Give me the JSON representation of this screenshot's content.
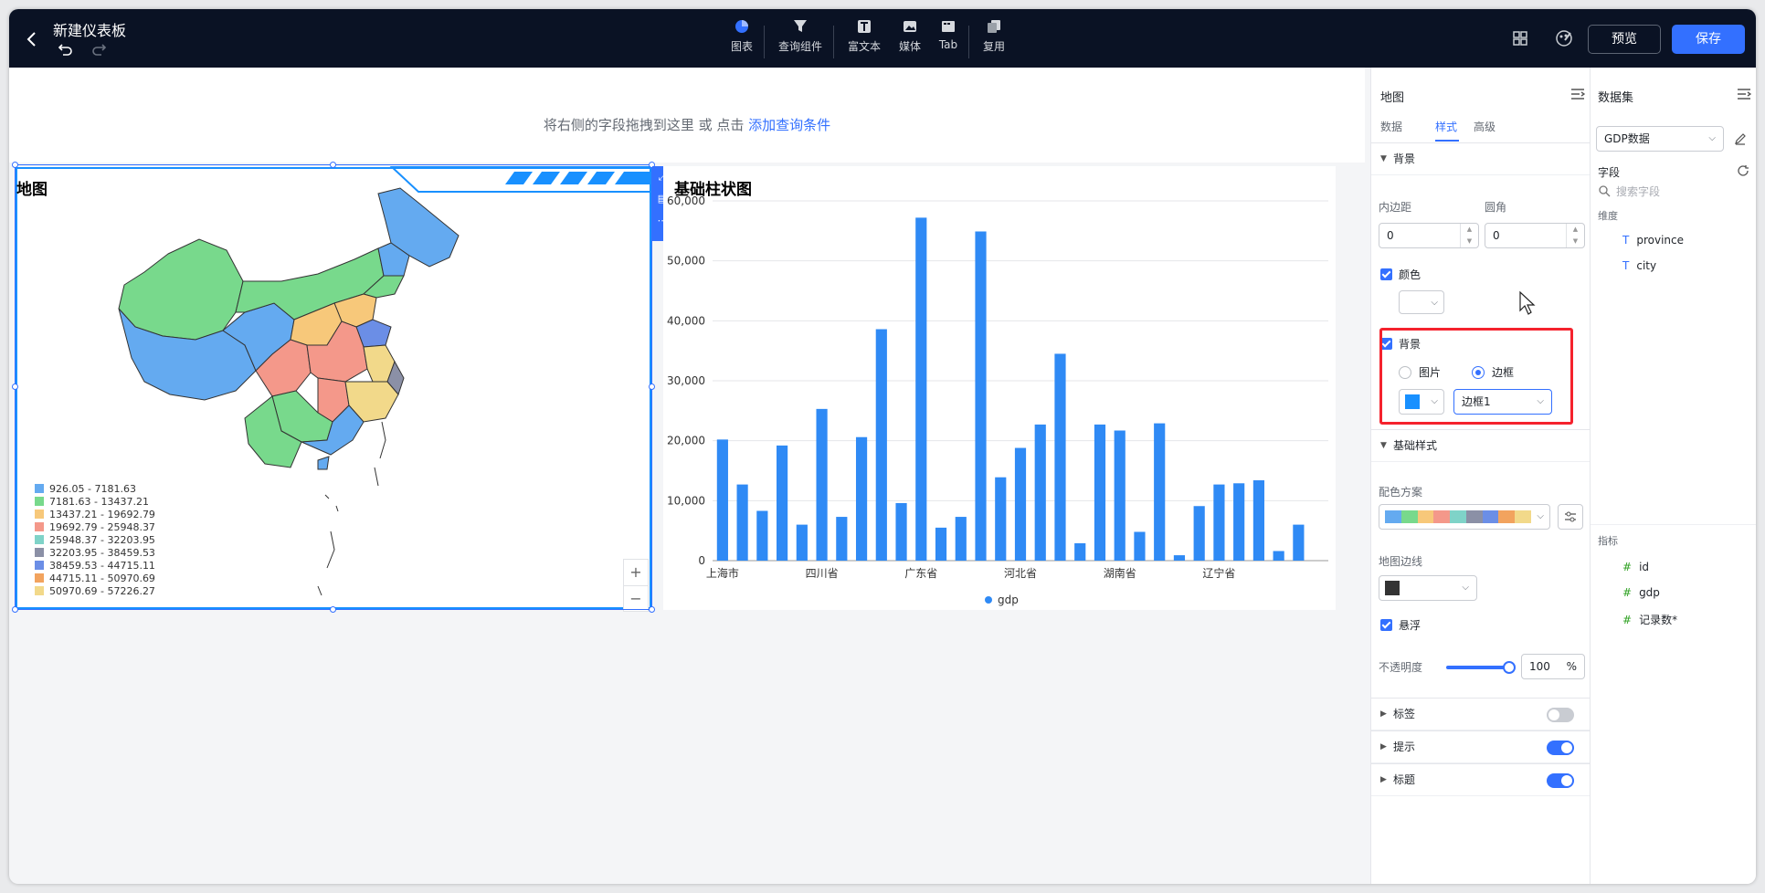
{
  "header": {
    "title": "新建仪表板",
    "tools": [
      {
        "label": "图表",
        "icon": "pie-chart-icon"
      },
      {
        "label": "查询组件",
        "icon": "filter-icon"
      },
      {
        "label": "富文本",
        "icon": "text-icon"
      },
      {
        "label": "媒体",
        "icon": "image-icon"
      },
      {
        "label": "Tab",
        "icon": "tab-icon"
      },
      {
        "label": "复用",
        "icon": "copy-icon"
      }
    ],
    "preview_label": "预览",
    "save_label": "保存"
  },
  "query_bar": {
    "text": "将右侧的字段拖拽到这里 或 点击",
    "link": "添加查询条件"
  },
  "map_chart": {
    "title": "地图",
    "legend": [
      {
        "range": "926.05 - 7181.63",
        "color": "#64aaf0"
      },
      {
        "range": "7181.63 - 13437.21",
        "color": "#78d98c"
      },
      {
        "range": "13437.21 - 19692.79",
        "color": "#f7c87a"
      },
      {
        "range": "19692.79 - 25948.37",
        "color": "#f4988a"
      },
      {
        "range": "25948.37 - 32203.95",
        "color": "#7fd3c8"
      },
      {
        "range": "32203.95 - 38459.53",
        "color": "#8b90a6"
      },
      {
        "range": "38459.53 - 44715.11",
        "color": "#6b8ee6"
      },
      {
        "range": "44715.11 - 50970.69",
        "color": "#f2a35e"
      },
      {
        "range": "50970.69 - 57226.27",
        "color": "#f2d98a"
      }
    ],
    "zoom_in": "+",
    "zoom_out": "−"
  },
  "bar_chart_title": "基础柱状图",
  "chart_data": {
    "type": "bar",
    "categories": [
      "上海市",
      "",
      "",
      "",
      "",
      "四川省",
      "",
      "",
      "",
      "",
      "广东省",
      "",
      "",
      "",
      "",
      "河北省",
      "",
      "",
      "",
      "",
      "湖南省",
      "",
      "",
      "",
      "",
      "辽宁省",
      "",
      "",
      "",
      "",
      ""
    ],
    "series": [
      {
        "name": "gdp",
        "values": [
          20200,
          12700,
          8300,
          19200,
          6000,
          25300,
          7300,
          20600,
          38600,
          9600,
          57200,
          5500,
          7300,
          54900,
          13900,
          18800,
          22700,
          34500,
          2900,
          22700,
          21700,
          4800,
          22900,
          900,
          9100,
          12700,
          12900,
          13400,
          1600,
          6000,
          0
        ],
        "color": "#2f8af5"
      }
    ],
    "ylim": [
      0,
      60000
    ],
    "yticks": [
      "0",
      "10,000",
      "20,000",
      "30,000",
      "40,000",
      "50,000",
      "60,000"
    ],
    "legend": "bottom-center",
    "grid": true
  },
  "style_panel": {
    "title": "地图",
    "tabs": [
      "数据",
      "样式",
      "高级"
    ],
    "active_tab": "样式",
    "bg_section": "背景",
    "padding_label": "内边距",
    "padding_value": "0",
    "radius_label": "圆角",
    "radius_value": "0",
    "color_label": "颜色",
    "bg_label": "背景",
    "bg_options": [
      "图片",
      "边框"
    ],
    "bg_selected": "边框",
    "border_value": "边框1",
    "border_color": "#1890ff",
    "basic_section": "基础样式",
    "scheme_label": "配色方案",
    "scheme_colors": [
      "#64aaf0",
      "#78d98c",
      "#f7c87a",
      "#f4988a",
      "#7fd3c8",
      "#8b90a6",
      "#6b8ee6",
      "#f2a35e",
      "#f2d98a"
    ],
    "map_border_label": "地图边线",
    "map_border_color": "#333333",
    "float_label": "悬浮",
    "opacity_label": "不透明度",
    "opacity_value": "100",
    "opacity_unit": "%",
    "label_section": "标签",
    "label_on": false,
    "tip_section": "提示",
    "tip_on": true,
    "title_section": "标题",
    "title_on": true
  },
  "data_panel": {
    "title": "数据集",
    "dataset": "GDP数据",
    "fields_label": "字段",
    "search_placeholder": "搜索字段",
    "dimensions_label": "维度",
    "dimensions": [
      "province",
      "city"
    ],
    "metrics_label": "指标",
    "metrics": [
      "id",
      "gdp",
      "记录数*"
    ]
  }
}
